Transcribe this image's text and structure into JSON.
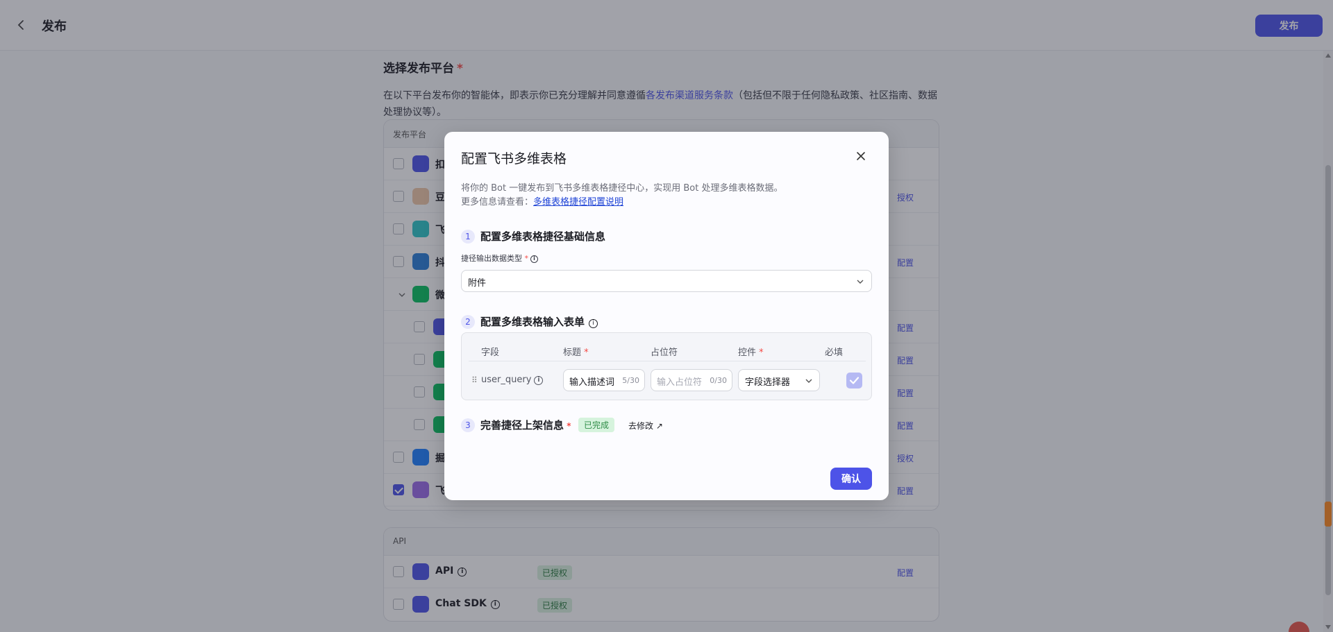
{
  "header": {
    "title": "发布",
    "publish_button": "发布"
  },
  "section": {
    "title": "选择发布平台",
    "required_mark": "*",
    "desc_prefix": "在以下平台发布你的智能体，即表示你已充分理解并同意遵循",
    "desc_link": "各发布渠道服务条款",
    "desc_suffix": "（包括但不限于任何隐私政策、社区指南、数据处理协议等）。"
  },
  "platform_card": {
    "header": "发布平台",
    "rows": [
      {
        "name": "扣",
        "checked": false,
        "action": "",
        "logo_color": "#4d53e8"
      },
      {
        "name": "豆",
        "checked": false,
        "action": "授权",
        "logo_color": "#f0c8a8"
      },
      {
        "name": "飞",
        "checked": false,
        "action": "",
        "logo_color": "#2ec7c9"
      },
      {
        "name": "抖",
        "checked": false,
        "action": "配置",
        "logo_color": "#2a7ed8"
      },
      {
        "name": "微",
        "checked": false,
        "action": "",
        "logo_color": "#07c160"
      },
      {
        "name": "",
        "checked": false,
        "action": "配置",
        "logo_color": "#4d53e8"
      },
      {
        "name": "",
        "checked": false,
        "action": "配置",
        "logo_color": "#07c160"
      },
      {
        "name": "",
        "checked": false,
        "action": "配置",
        "logo_color": "#07c160"
      },
      {
        "name": "",
        "checked": false,
        "action": "配置",
        "logo_color": "#07c160"
      },
      {
        "name": "掘",
        "checked": false,
        "action": "授权",
        "logo_color": "#1e80ff"
      },
      {
        "name": "飞",
        "checked": true,
        "action": "配置",
        "logo_color": "#9b6be8"
      }
    ]
  },
  "api_card": {
    "header": "API",
    "rows": [
      {
        "name": "API",
        "badge": "已授权",
        "action": "配置"
      },
      {
        "name": "Chat SDK",
        "badge": "已授权",
        "action": ""
      }
    ]
  },
  "modal": {
    "title": "配置飞书多维表格",
    "desc_line1": "将你的 Bot 一键发布到飞书多维表格捷径中心，实现用 Bot 处理多维表格数据。",
    "desc_line2_prefix": "更多信息请查看：",
    "desc_link": "多维表格捷径配置说明",
    "step1": {
      "num": "1",
      "title": "配置多维表格捷径基础信息"
    },
    "output_type_label": "捷径输出数据类型",
    "output_type_value": "附件",
    "step2": {
      "num": "2",
      "title": "配置多维表格输入表单"
    },
    "table": {
      "columns": [
        "字段",
        "标题",
        "占位符",
        "控件",
        "必填"
      ],
      "row": {
        "field": "user_query",
        "title_value": "输入描述词",
        "title_count": "5/30",
        "placeholder_hint": "输入占位符",
        "placeholder_count": "0/30",
        "control": "字段选择器",
        "required": true
      }
    },
    "step3": {
      "num": "3",
      "title": "完善捷径上架信息"
    },
    "status_badge": "已完成",
    "edit_link": "去修改 ↗",
    "confirm": "确认"
  },
  "colors": {
    "accent": "#4d53e8",
    "success_bg": "#d6f3dd",
    "required": "#f54a45"
  }
}
